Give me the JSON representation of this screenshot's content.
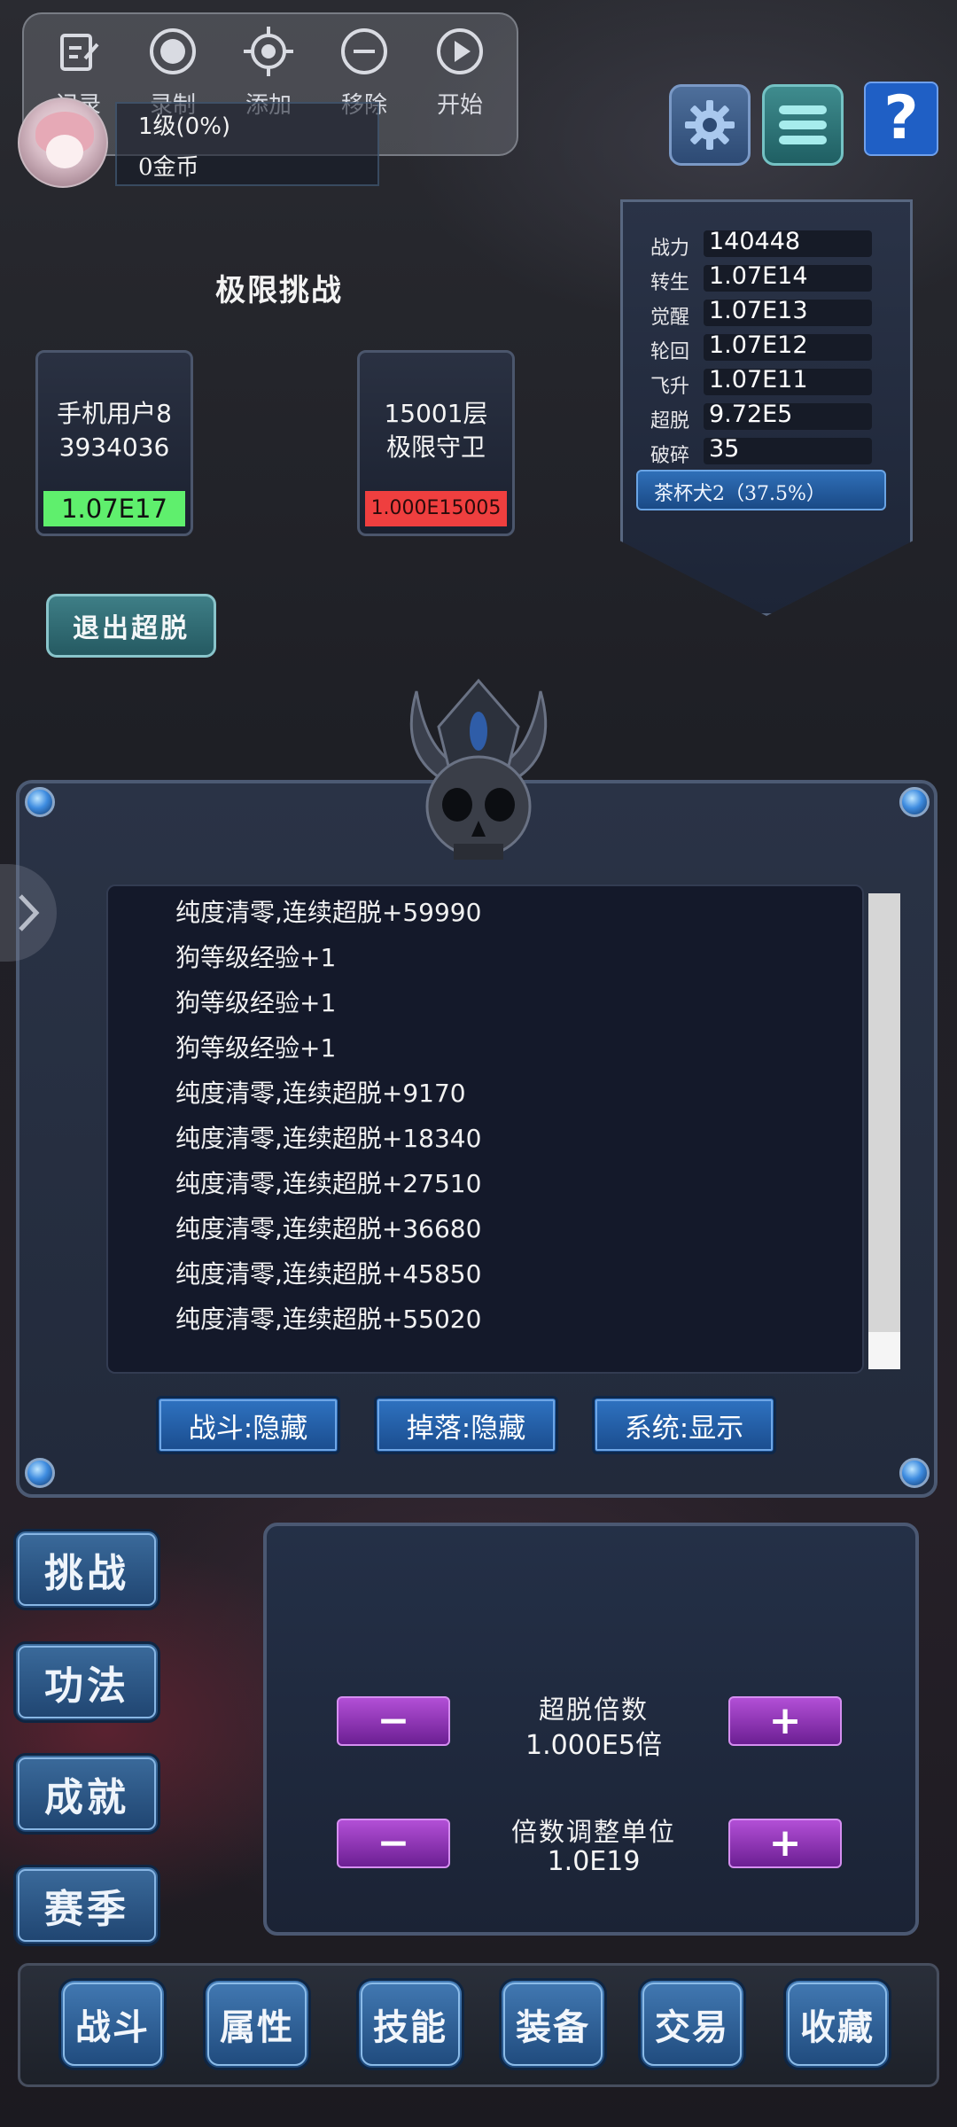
{
  "recorder": {
    "items": [
      {
        "label": "记录",
        "icon": "edit-icon"
      },
      {
        "label": "录制",
        "icon": "record-icon"
      },
      {
        "label": "添加",
        "icon": "crosshair-icon"
      },
      {
        "label": "移除",
        "icon": "minus-circle-icon"
      },
      {
        "label": "开始",
        "icon": "play-icon"
      }
    ]
  },
  "player": {
    "level_text": "1级(0%)",
    "gold_text": "0金币"
  },
  "top_buttons": {
    "settings_icon": "gear-icon",
    "menu_icon": "menu-icon",
    "help_label": "?"
  },
  "stats": {
    "rows": [
      {
        "label": "战力",
        "value": "140448"
      },
      {
        "label": "转生",
        "value": "1.07E14"
      },
      {
        "label": "觉醒",
        "value": "1.07E13"
      },
      {
        "label": "轮回",
        "value": "1.07E12"
      },
      {
        "label": "飞升",
        "value": "1.07E11"
      },
      {
        "label": "超脱",
        "value": "9.72E5"
      },
      {
        "label": "破碎",
        "value": "35"
      }
    ],
    "pet": "茶杯犬2（37.5%）"
  },
  "challenge": {
    "title": "极限挑战",
    "player_name": "手机用户8\n3934036",
    "player_power": "1.07E17",
    "enemy_name": "15001层\n极限守卫",
    "enemy_power": "1.000E15005",
    "exit_label": "退出超脱"
  },
  "log": {
    "lines": [
      "纯度清零,连续超脱+59990",
      "狗等级经验+1",
      "狗等级经验+1",
      "狗等级经验+1",
      "纯度清零,连续超脱+9170",
      "纯度清零,连续超脱+18340",
      "纯度清零,连续超脱+27510",
      "纯度清零,连续超脱+36680",
      "纯度清零,连续超脱+45850",
      "纯度清零,连续超脱+55020"
    ],
    "filters": {
      "battle": "战斗:隐藏",
      "drop": "掉落:隐藏",
      "system": "系统:显示"
    }
  },
  "side_menu": {
    "challenge": "挑战",
    "skill_method": "功法",
    "achievement": "成就",
    "season": "赛季"
  },
  "multiplier": {
    "label": "超脱倍数",
    "value": "1.000E5倍",
    "unit_label": "倍数调整单位",
    "unit_value": "1.0E19",
    "minus": "−",
    "plus": "+"
  },
  "bottom_nav": {
    "battle": "战斗",
    "attributes": "属性",
    "skills": "技能",
    "equipment": "装备",
    "trade": "交易",
    "collection": "收藏"
  },
  "colors": {
    "player_power_bg": "#5fef6d",
    "enemy_power_bg": "#ef3f3f",
    "button_blue": "#2f73c2",
    "button_purple": "#b24fd6"
  }
}
